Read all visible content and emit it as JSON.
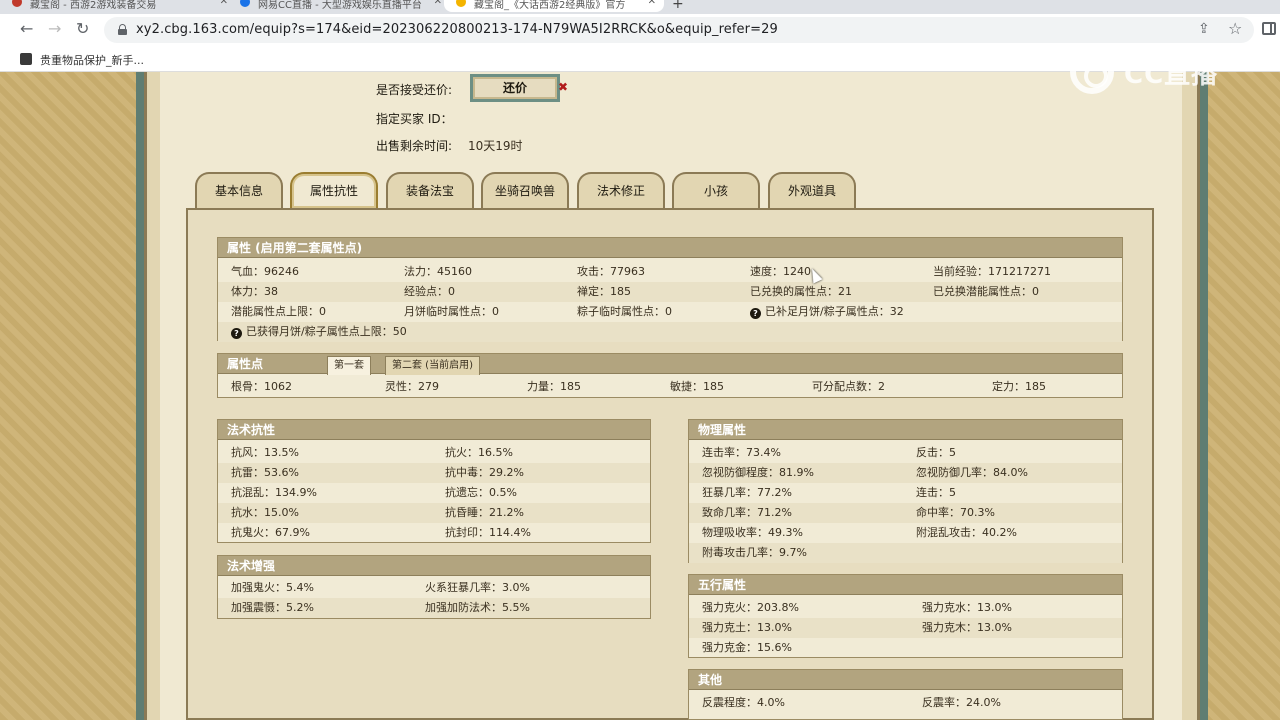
{
  "browser": {
    "tabs": [
      {
        "title": "藏宝阁 - 西游2游戏装备交易",
        "active": false
      },
      {
        "title": "网易CC直播 - 大型游戏娱乐直播平台",
        "active": false
      },
      {
        "title": "藏宝阁_《大话西游2经典版》官方",
        "active": true
      }
    ],
    "url": "xy2.cbg.163.com/equip?s=174&eid=202306220800213-174-N79WA5I2RRCK&o&equip_refer=29",
    "bookmark": "贵重物品保护_新手..."
  },
  "watermark": {
    "text": "CC直播"
  },
  "top_info": {
    "accept_counter_label": "是否接受还价:",
    "counter_button": "还价",
    "buyer_id_label": "指定买家 ID：",
    "remaining_label": "出售剩余时间:",
    "remaining_value": "10天19时"
  },
  "tabs": [
    "基本信息",
    "属性抗性",
    "装备法宝",
    "坐骑召唤兽",
    "法术修正",
    "小孩",
    "外观道具"
  ],
  "attributes": {
    "title": "属性 (启用第二套属性点)",
    "rows": [
      [
        "气血：96246",
        "法力：45160",
        "攻击：77963",
        "速度：1240",
        "当前经验：171217271"
      ],
      [
        "体力：38",
        "经验点：0",
        "禅定：185",
        "已兑换的属性点：21",
        "已兑换潜能属性点：0"
      ],
      [
        "潜能属性点上限：0",
        "月饼临时属性点：0",
        "粽子临时属性点：0",
        "已补足月饼/粽子属性点：32",
        ""
      ],
      [
        "已获得月饼/粽子属性点上限：50"
      ]
    ]
  },
  "attr_points": {
    "title": "属性点",
    "subtabs": [
      "第一套",
      "第二套 (当前启用)"
    ],
    "values": [
      "根骨：1062",
      "灵性：279",
      "力量：185",
      "敏捷：185",
      "可分配点数：2",
      "定力：185"
    ]
  },
  "spell_resist": {
    "title": "法术抗性",
    "rows": [
      [
        "抗风：13.5%",
        "抗火：16.5%"
      ],
      [
        "抗雷：53.6%",
        "抗中毒：29.2%"
      ],
      [
        "抗混乱：134.9%",
        "抗遗忘：0.5%"
      ],
      [
        "抗水：15.0%",
        "抗昏睡：21.2%"
      ],
      [
        "抗鬼火：67.9%",
        "抗封印：114.4%"
      ]
    ]
  },
  "spell_boost": {
    "title": "法术增强",
    "rows": [
      [
        "加强鬼火：5.4%",
        "火系狂暴几率：3.0%"
      ],
      [
        "加强震慑：5.2%",
        "加强加防法术：5.5%"
      ]
    ]
  },
  "physical": {
    "title": "物理属性",
    "rows": [
      [
        "连击率：73.4%",
        "反击：5"
      ],
      [
        "忽视防御程度：81.9%",
        "忽视防御几率：84.0%"
      ],
      [
        "狂暴几率：77.2%",
        "连击：5"
      ],
      [
        "致命几率：71.2%",
        "命中率：70.3%"
      ],
      [
        "物理吸收率：49.3%",
        "附混乱攻击：40.2%"
      ],
      [
        "附毒攻击几率：9.7%",
        ""
      ]
    ]
  },
  "five_elements": {
    "title": "五行属性",
    "rows": [
      [
        "强力克火：203.8%",
        "强力克水：13.0%"
      ],
      [
        "强力克土：13.0%",
        "强力克木：13.0%"
      ],
      [
        "强力克金：15.6%",
        ""
      ]
    ]
  },
  "other": {
    "title": "其他",
    "rows": [
      [
        "反震程度：4.0%",
        "反震率：24.0%"
      ]
    ]
  }
}
